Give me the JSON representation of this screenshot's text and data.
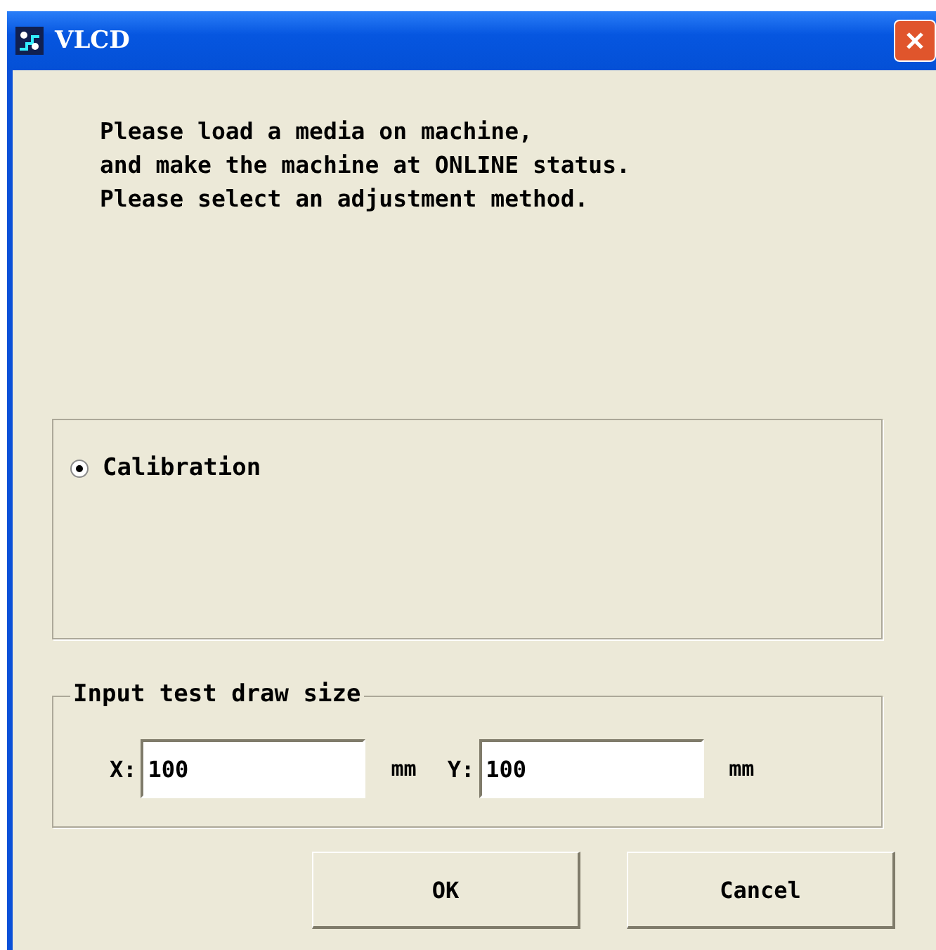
{
  "window": {
    "title": "VLCD"
  },
  "message": [
    "Please load a media on machine,",
    "and make the machine at ONLINE status.",
    "Please select an adjustment method."
  ],
  "method": {
    "options": [
      {
        "label": "Calibration",
        "selected": true
      }
    ]
  },
  "size_group": {
    "title": "Input test draw size",
    "fields": [
      {
        "label": "X:",
        "value": "100",
        "unit": "mm"
      },
      {
        "label": "Y:",
        "value": "100",
        "unit": "mm"
      }
    ]
  },
  "buttons": [
    "OK",
    "Cancel"
  ]
}
